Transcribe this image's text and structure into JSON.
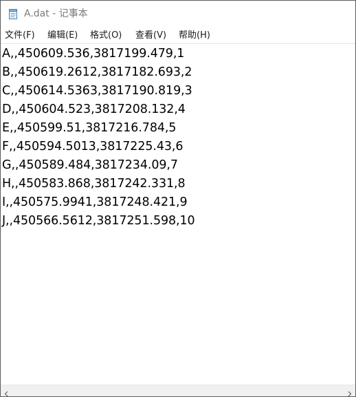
{
  "window": {
    "title": "A.dat - 记事本",
    "app_icon": "notepad-icon"
  },
  "menubar": {
    "items": [
      {
        "label": "文件(F)"
      },
      {
        "label": "编辑(E)"
      },
      {
        "label": "格式(O)"
      },
      {
        "label": "查看(V)"
      },
      {
        "label": "帮助(H)"
      }
    ]
  },
  "document": {
    "lines": [
      "A,,450609.536,3817199.479,1",
      "B,,450619.2612,3817182.693,2",
      "C,,450614.5363,3817190.819,3",
      "D,,450604.523,3817208.132,4",
      "E,,450599.51,3817216.784,5",
      "F,,450594.5013,3817225.43,6",
      "G,,450589.484,3817234.09,7",
      "H,,450583.868,3817242.331,8",
      "I,,450575.9941,3817248.421,9",
      "J,,450566.5612,3817251.598,10"
    ]
  },
  "scrollbar": {
    "left_arrow_icon": "chevron-left-icon",
    "right_arrow_icon": "chevron-right-icon"
  }
}
